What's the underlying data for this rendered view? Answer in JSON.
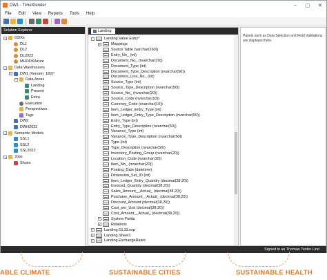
{
  "window": {
    "title": "DW1 - TimeXtender",
    "controls": [
      "–",
      "▢",
      "✕"
    ]
  },
  "menu": [
    "File",
    "Edit",
    "View",
    "Reports",
    "Tools",
    "Help"
  ],
  "solution_explorer": {
    "title": "Solution Explorer",
    "items": [
      {
        "label": "ODXs",
        "level": 0,
        "expander": "−",
        "icon": "folder-icon"
      },
      {
        "label": "DL1",
        "level": 1,
        "expander": "",
        "icon": "database-icon"
      },
      {
        "label": "DL2",
        "level": 1,
        "expander": "",
        "icon": "database-icon"
      },
      {
        "label": "DL2022",
        "level": 1,
        "expander": "",
        "icon": "database-icon"
      },
      {
        "label": "MHODXAzure",
        "level": 1,
        "expander": "",
        "icon": "database-icon"
      },
      {
        "label": "Data Warehouses",
        "level": 0,
        "expander": "−",
        "icon": "folder-icon"
      },
      {
        "label": "DW1 (Version: 182)*",
        "level": 1,
        "expander": "−",
        "icon": "warehouse-icon"
      },
      {
        "label": "Data Areas",
        "level": 2,
        "expander": "−",
        "icon": "folder-icon"
      },
      {
        "label": "Landing",
        "level": 3,
        "expander": "",
        "icon": "data-area-icon"
      },
      {
        "label": "Present",
        "level": 3,
        "expander": "",
        "icon": "data-area-icon"
      },
      {
        "label": "Extra",
        "level": 3,
        "expander": "",
        "icon": "data-area-icon"
      },
      {
        "label": "Execution",
        "level": 2,
        "expander": "",
        "icon": "gear-icon"
      },
      {
        "label": "Perspectives",
        "level": 2,
        "expander": "",
        "icon": "folder-icon"
      },
      {
        "label": "Tags",
        "level": 2,
        "expander": "",
        "icon": "tag-icon"
      },
      {
        "label": "DW2",
        "level": 1,
        "expander": "",
        "icon": "warehouse-icon"
      },
      {
        "label": "DWH2022",
        "level": 1,
        "expander": "",
        "icon": "warehouse-icon"
      },
      {
        "label": "Semantic Models",
        "level": 0,
        "expander": "−",
        "icon": "folder-icon"
      },
      {
        "label": "SSL1",
        "level": 1,
        "expander": "",
        "icon": "model-icon"
      },
      {
        "label": "SSL2",
        "level": 1,
        "expander": "",
        "icon": "model-icon"
      },
      {
        "label": "SSL2022",
        "level": 1,
        "expander": "",
        "icon": "model-icon"
      },
      {
        "label": "Jobs",
        "level": 0,
        "expander": "−",
        "icon": "folder-icon"
      },
      {
        "label": "Shoes",
        "level": 1,
        "expander": "",
        "icon": "job-icon"
      }
    ]
  },
  "main_tab": {
    "label": "Landing"
  },
  "table_tree": {
    "root": "Landing.Value Entry*",
    "fields": [
      {
        "label": "Mappings",
        "level": 1,
        "expander": "+"
      },
      {
        "label": "Source Table (varchar(260))",
        "level": 1,
        "expander": ""
      },
      {
        "label": "Entry_No_ (int)",
        "level": 1,
        "expander": ""
      },
      {
        "label": "Document_No_ (nvarchar(20))",
        "level": 1,
        "expander": ""
      },
      {
        "label": "Document_Type (int)",
        "level": 1,
        "expander": ""
      },
      {
        "label": "Document_Type_Description (nvarchar(50))",
        "level": 1,
        "expander": ""
      },
      {
        "label": "Document_Line_No_ (int)",
        "level": 1,
        "expander": ""
      },
      {
        "label": "Source_Type (int)",
        "level": 1,
        "expander": ""
      },
      {
        "label": "Source_Type_Description (nvarchar(50))",
        "level": 1,
        "expander": ""
      },
      {
        "label": "Source_No_ (nvarchar(20))",
        "level": 1,
        "expander": ""
      },
      {
        "label": "Source_Code (nvarchar(10))",
        "level": 1,
        "expander": ""
      },
      {
        "label": "Currency_Code (nvarchar(10))",
        "level": 1,
        "expander": ""
      },
      {
        "label": "Item_Ledger_Entry_Type (int)",
        "level": 1,
        "expander": ""
      },
      {
        "label": "Item_Ledger_Entry_Type_Description (nvarchar(50))",
        "level": 1,
        "expander": ""
      },
      {
        "label": "Entry_Type (int)",
        "level": 1,
        "expander": ""
      },
      {
        "label": "Entry_Type_Description (nvarchar(50))",
        "level": 1,
        "expander": ""
      },
      {
        "label": "Variance_Type (int)",
        "level": 1,
        "expander": ""
      },
      {
        "label": "Variance_Type_Description (nvarchar(50))",
        "level": 1,
        "expander": ""
      },
      {
        "label": "Type (int)",
        "level": 1,
        "expander": ""
      },
      {
        "label": "Type_Description (nvarchar(50))",
        "level": 1,
        "expander": ""
      },
      {
        "label": "Inventory_Posting_Group (nvarchar(20))",
        "level": 1,
        "expander": ""
      },
      {
        "label": "Location_Code (nvarchar(10))",
        "level": 1,
        "expander": ""
      },
      {
        "label": "Item_No_ (nvarchar(20))",
        "level": 1,
        "expander": ""
      },
      {
        "label": "Posting_Date (datetime)",
        "level": 1,
        "expander": ""
      },
      {
        "label": "Dimension_Set_ID (int)",
        "level": 1,
        "expander": ""
      },
      {
        "label": "Item_Ledger_Entry_Quantity (decimal(38,20))",
        "level": 1,
        "expander": ""
      },
      {
        "label": "Invoiced_Quantity (decimal(38,20))",
        "level": 1,
        "expander": ""
      },
      {
        "label": "Sales_Amount__Actual_ (decimal(38,20))",
        "level": 1,
        "expander": ""
      },
      {
        "label": "Purchase_Amount__Actual_ (decimal(38,20))",
        "level": 1,
        "expander": ""
      },
      {
        "label": "Discount_Amount (decimal(38,20))",
        "level": 1,
        "expander": ""
      },
      {
        "label": "Cost_per_Unit (decimal(38,20))",
        "level": 1,
        "expander": ""
      },
      {
        "label": "Cost_Amount__Actual_ (decimal(38,20))",
        "level": 1,
        "expander": ""
      },
      {
        "label": "System Fields",
        "level": 1,
        "expander": "+"
      },
      {
        "label": "Relations",
        "level": 1,
        "expander": "+"
      },
      {
        "label": "Landing.GL33.exp",
        "level": 0,
        "expander": "+"
      },
      {
        "label": "Landing.Sheet1",
        "level": 0,
        "expander": "+"
      },
      {
        "label": "Landing.ExchangeRates",
        "level": 0,
        "expander": "+"
      }
    ]
  },
  "info_panel": {
    "text": "Panels such as Data Selection and Field Validations are displayed here."
  },
  "status": {
    "text": "Signed in as Thomas Tester Lind"
  },
  "background_banner": [
    "ABLE CLIMATE",
    "SUSTAINABLE CITIES",
    "SUSTAINABLE HEALTH"
  ],
  "colors": {
    "accent": "#e8782c",
    "dark_bar": "#2b2b2b",
    "panel_bg": "#ffffff"
  }
}
